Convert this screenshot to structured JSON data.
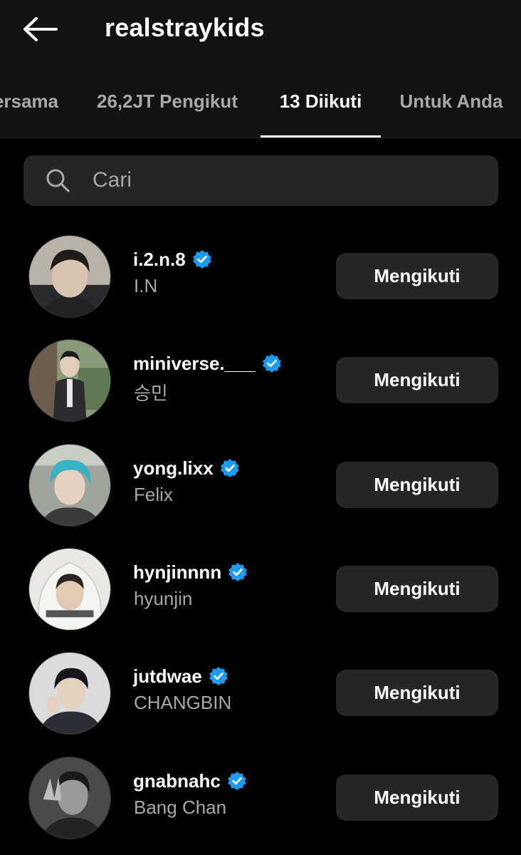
{
  "header": {
    "back_icon": "arrow-left-icon",
    "title": "realstraykids"
  },
  "tabs": [
    {
      "label": "ersama",
      "active": false
    },
    {
      "label": "26,2JT Pengikut",
      "active": false
    },
    {
      "label": "13 Diikuti",
      "active": true
    },
    {
      "label": "Untuk Anda",
      "active": false
    }
  ],
  "search": {
    "icon": "search-icon",
    "placeholder": "Cari",
    "value": ""
  },
  "colors": {
    "background": "#000000",
    "header_bg": "#121212",
    "surface": "#262626",
    "secondary_text": "#a8a8a8",
    "verified_blue": "#1d9bf0"
  },
  "following": [
    {
      "username": "i.2.n.8",
      "fullname": "I.N",
      "verified": true,
      "button": "Mengikuti"
    },
    {
      "username": "miniverse.___",
      "fullname": "승민",
      "verified": true,
      "button": "Mengikuti"
    },
    {
      "username": "yong.lixx",
      "fullname": "Felix",
      "verified": true,
      "button": "Mengikuti"
    },
    {
      "username": "hynjinnnn",
      "fullname": "hyunjin",
      "verified": true,
      "button": "Mengikuti"
    },
    {
      "username": "jutdwae",
      "fullname": "CHANGBIN",
      "verified": true,
      "button": "Mengikuti"
    },
    {
      "username": "gnabnahc",
      "fullname": "Bang Chan",
      "verified": true,
      "button": "Mengikuti"
    }
  ]
}
